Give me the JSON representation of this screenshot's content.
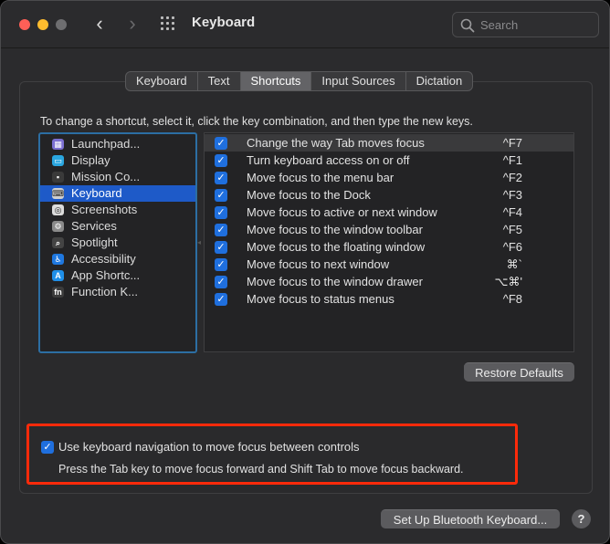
{
  "window": {
    "title": "Keyboard"
  },
  "search": {
    "placeholder": "Search"
  },
  "tabs": [
    {
      "label": "Keyboard",
      "active": false
    },
    {
      "label": "Text",
      "active": false
    },
    {
      "label": "Shortcuts",
      "active": true
    },
    {
      "label": "Input Sources",
      "active": false
    },
    {
      "label": "Dictation",
      "active": false
    }
  ],
  "instructions": "To change a shortcut, select it, click the key combination, and then type the new keys.",
  "sidebar": {
    "items": [
      {
        "label": "Launchpad...",
        "icon": "launchpad-icon",
        "color": "#7b6fd1",
        "glyph": "▦",
        "selected": false
      },
      {
        "label": "Display",
        "icon": "display-icon",
        "color": "#2aa6e0",
        "glyph": "▭",
        "selected": false
      },
      {
        "label": "Mission Co...",
        "icon": "mission-control-icon",
        "color": "#3a3a3a",
        "glyph": "▪",
        "selected": false
      },
      {
        "label": "Keyboard",
        "icon": "keyboard-icon",
        "color": "#cfcfcf",
        "glyph": "⌨",
        "selected": true
      },
      {
        "label": "Screenshots",
        "icon": "screenshots-icon",
        "color": "#dcdcdc",
        "glyph": "◎",
        "selected": false
      },
      {
        "label": "Services",
        "icon": "services-icon",
        "color": "#8a8a8a",
        "glyph": "⚙",
        "selected": false
      },
      {
        "label": "Spotlight",
        "icon": "spotlight-icon",
        "color": "#444444",
        "glyph": "⌕",
        "selected": false
      },
      {
        "label": "Accessibility",
        "icon": "accessibility-icon",
        "color": "#1f78e0",
        "glyph": "♿",
        "selected": false
      },
      {
        "label": "App Shortc...",
        "icon": "app-shortcuts-icon",
        "color": "#1f8fe8",
        "glyph": "A",
        "selected": false
      },
      {
        "label": "Function K...",
        "icon": "function-keys-icon",
        "color": "#3c3c3c",
        "glyph": "fn",
        "selected": false
      }
    ]
  },
  "shortcuts": [
    {
      "label": "Change the way Tab moves focus",
      "key": "^F7",
      "checked": true
    },
    {
      "label": "Turn keyboard access on or off",
      "key": "^F1",
      "checked": true
    },
    {
      "label": "Move focus to the menu bar",
      "key": "^F2",
      "checked": true
    },
    {
      "label": "Move focus to the Dock",
      "key": "^F3",
      "checked": true
    },
    {
      "label": "Move focus to active or next window",
      "key": "^F4",
      "checked": true
    },
    {
      "label": "Move focus to the window toolbar",
      "key": "^F5",
      "checked": true
    },
    {
      "label": "Move focus to the floating window",
      "key": "^F6",
      "checked": true
    },
    {
      "label": "Move focus to next window",
      "key": "⌘`",
      "checked": true
    },
    {
      "label": "Move focus to the window drawer",
      "key": "⌥⌘'",
      "checked": true
    },
    {
      "label": "Move focus to status menus",
      "key": "^F8",
      "checked": true
    }
  ],
  "buttons": {
    "restore": "Restore Defaults",
    "bluetooth": "Set Up Bluetooth Keyboard...",
    "help": "?"
  },
  "keyboard_navigation": {
    "checked": true,
    "label": "Use keyboard navigation to move focus between controls",
    "description": "Press the Tab key to move focus forward and Shift Tab to move focus backward."
  }
}
